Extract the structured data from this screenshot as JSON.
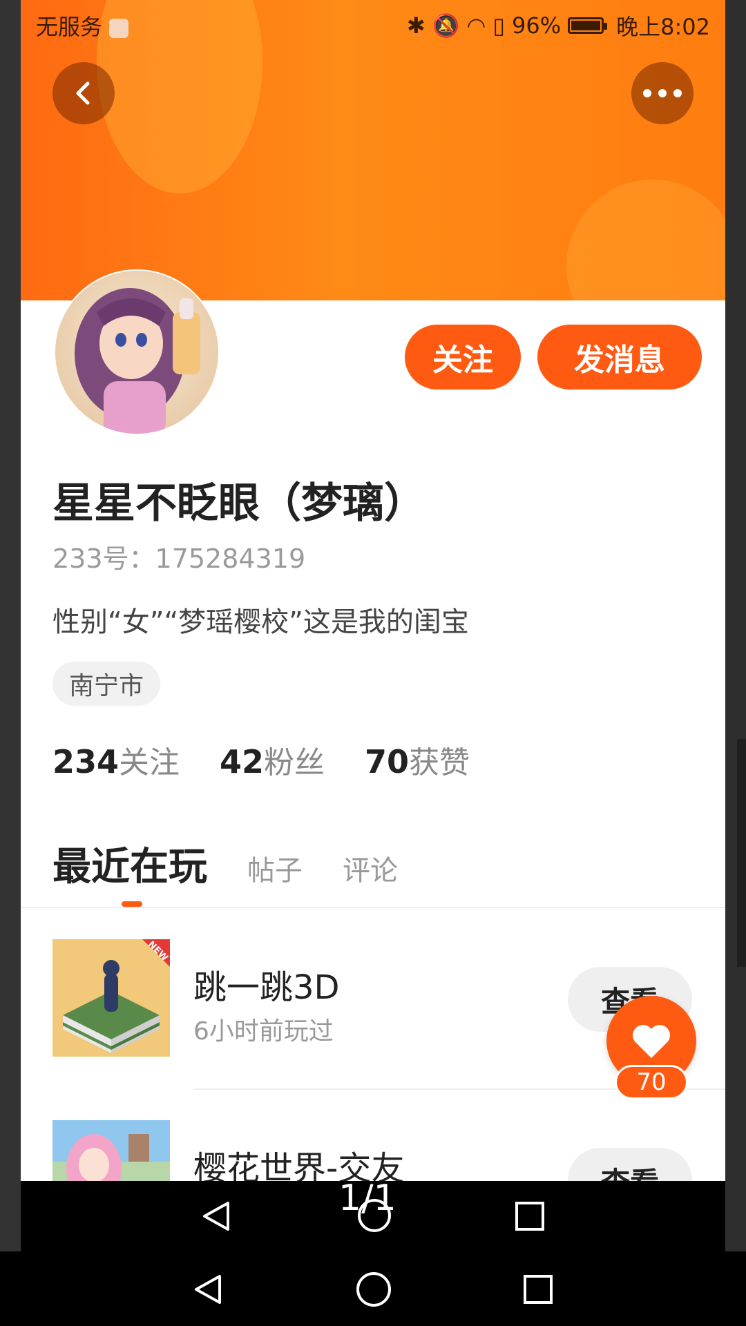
{
  "status_bar": {
    "carrier": "无服务",
    "battery": "96%",
    "time": "晚上8:02"
  },
  "header": {
    "back_icon": "chevron-left-icon",
    "more_icon": "more-dots-icon"
  },
  "profile": {
    "name": "星星不眨眼（梦璃）",
    "uid": "233号：175284319",
    "bio": "性别“女”“梦瑶樱校”这是我的闺宝",
    "location": "南宁市",
    "follow_label": "关注",
    "message_label": "发消息",
    "stats": [
      {
        "num": "234",
        "label": "关注"
      },
      {
        "num": "42",
        "label": "粉丝"
      },
      {
        "num": "70",
        "label": "获赞"
      }
    ]
  },
  "tabs": [
    {
      "label": "最近在玩",
      "active": true
    },
    {
      "label": "帖子",
      "active": false
    },
    {
      "label": "评论",
      "active": false
    }
  ],
  "games": [
    {
      "title": "跳一跳3D",
      "subtitle": "6小时前玩过",
      "badge": "NEW",
      "button": "查看"
    },
    {
      "title": "樱花世界-交友",
      "subtitle": "",
      "button": "查看"
    }
  ],
  "like_fab": {
    "count": "70"
  },
  "page_indicator": "1/1",
  "colors": {
    "accent": "#ff5a12",
    "banner": "#ff7d10"
  }
}
